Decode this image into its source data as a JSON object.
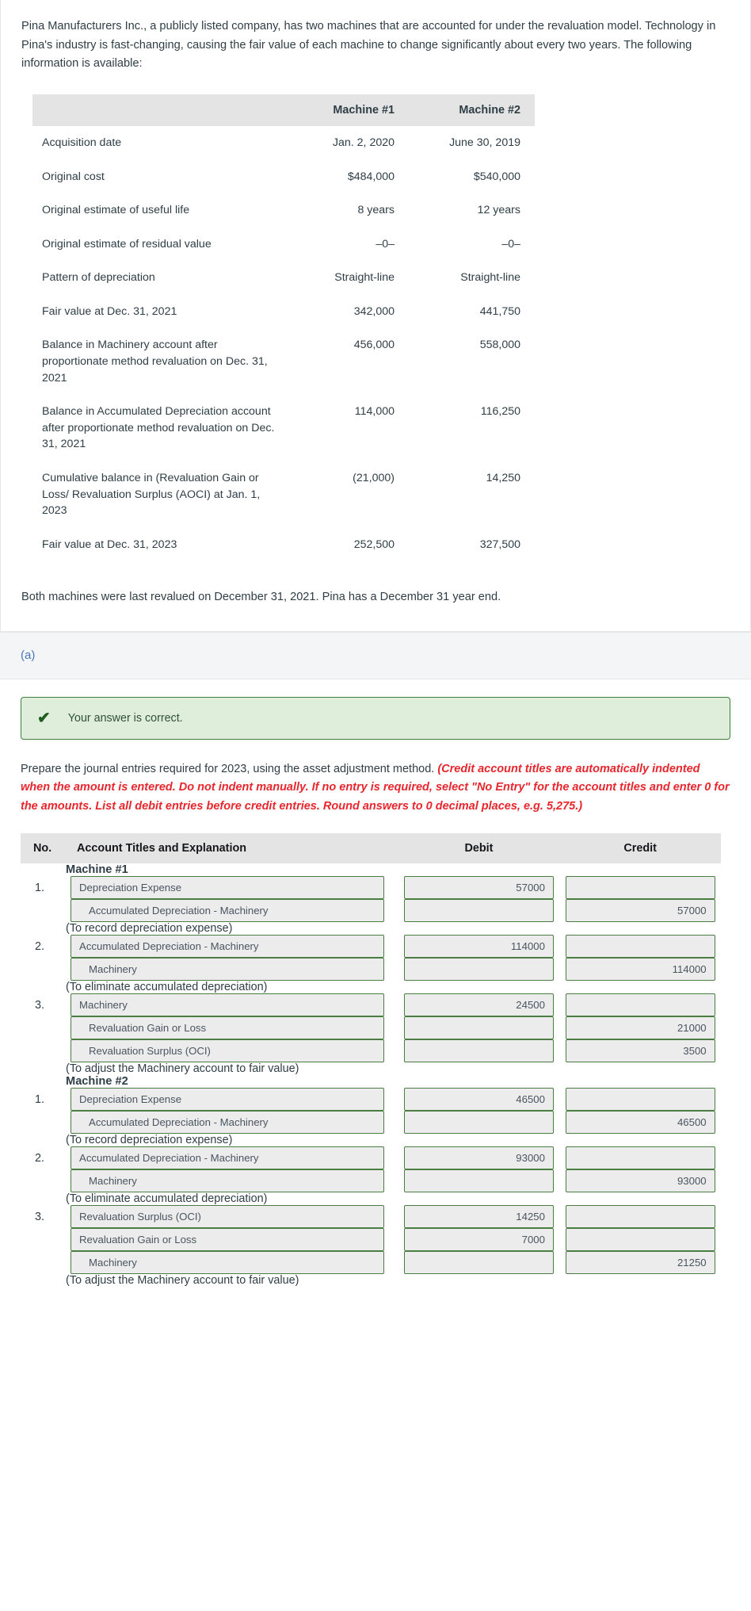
{
  "problem": {
    "intro": "Pina Manufacturers Inc., a publicly listed company, has two machines that are accounted for under the revaluation model. Technology in Pina's industry is fast-changing, causing the fair value of each machine to change significantly about every two years. The following information is available:",
    "closing_note": "Both machines were last revalued on December 31, 2021. Pina has a December 31 year end."
  },
  "data_table": {
    "headers": [
      "",
      "Machine #1",
      "Machine #2"
    ],
    "rows": [
      {
        "label": "Acquisition date",
        "m1": "Jan. 2, 2020",
        "m2": "June 30, 2019"
      },
      {
        "label": "Original cost",
        "m1": "$484,000",
        "m2": "$540,000"
      },
      {
        "label": "Original estimate of useful life",
        "m1": "8 years",
        "m2": "12 years"
      },
      {
        "label": "Original estimate of residual value",
        "m1": "–0–",
        "m2": "–0–"
      },
      {
        "label": "Pattern of depreciation",
        "m1": "Straight-line",
        "m2": "Straight-line"
      },
      {
        "label": "Fair value at Dec. 31, 2021",
        "m1": "342,000",
        "m2": "441,750"
      },
      {
        "label": "Balance in Machinery account after proportionate method revaluation on Dec. 31, 2021",
        "m1": "456,000",
        "m2": "558,000"
      },
      {
        "label": "Balance in Accumulated Depreciation account after proportionate method revaluation on Dec. 31, 2021",
        "m1": "114,000",
        "m2": "116,250"
      },
      {
        "label": "Cumulative balance in (Revaluation Gain or Loss/ Revaluation Surplus (AOCI) at Jan. 1, 2023",
        "m1": "(21,000)",
        "m2": "14,250"
      },
      {
        "label": "Fair value at Dec. 31, 2023",
        "m1": "252,500",
        "m2": "327,500"
      }
    ]
  },
  "part": {
    "label": "(a)"
  },
  "feedback": {
    "icon": "check-icon",
    "text": "Your answer is correct."
  },
  "instructions": {
    "lead": "Prepare the journal entries required for 2023, using the asset adjustment method. ",
    "hint": "(Credit account titles are automatically indented when the amount is entered. Do not indent manually. If no entry is required, select \"No Entry\" for the account titles and enter 0 for the amounts. List all debit entries before credit entries. Round answers to 0 decimal places, e.g. 5,275.)"
  },
  "journal": {
    "headers": {
      "no": "No.",
      "account": "Account Titles and Explanation",
      "debit": "Debit",
      "credit": "Credit"
    },
    "sections": [
      {
        "heading": "Machine #1",
        "entries": [
          {
            "no": "1.",
            "lines": [
              {
                "account": "Depreciation Expense",
                "indent": false,
                "debit": "57000",
                "credit": ""
              },
              {
                "account": "Accumulated Depreciation - Machinery",
                "indent": true,
                "debit": "",
                "credit": "57000"
              }
            ],
            "memo": "(To record depreciation expense)"
          },
          {
            "no": "2.",
            "lines": [
              {
                "account": "Accumulated Depreciation - Machinery",
                "indent": false,
                "debit": "114000",
                "credit": ""
              },
              {
                "account": "Machinery",
                "indent": true,
                "debit": "",
                "credit": "114000"
              }
            ],
            "memo": "(To eliminate accumulated depreciation)"
          },
          {
            "no": "3.",
            "lines": [
              {
                "account": "Machinery",
                "indent": false,
                "debit": "24500",
                "credit": ""
              },
              {
                "account": "Revaluation Gain or Loss",
                "indent": true,
                "debit": "",
                "credit": "21000"
              },
              {
                "account": "Revaluation Surplus (OCI)",
                "indent": true,
                "debit": "",
                "credit": "3500"
              }
            ],
            "memo": "(To adjust the Machinery account to fair value)"
          }
        ]
      },
      {
        "heading": "Machine #2",
        "entries": [
          {
            "no": "1.",
            "lines": [
              {
                "account": "Depreciation Expense",
                "indent": false,
                "debit": "46500",
                "credit": ""
              },
              {
                "account": "Accumulated Depreciation - Machinery",
                "indent": true,
                "debit": "",
                "credit": "46500"
              }
            ],
            "memo": "(To record depreciation expense)"
          },
          {
            "no": "2.",
            "lines": [
              {
                "account": "Accumulated Depreciation - Machinery",
                "indent": false,
                "debit": "93000",
                "credit": ""
              },
              {
                "account": "Machinery",
                "indent": true,
                "debit": "",
                "credit": "93000"
              }
            ],
            "memo": "(To eliminate accumulated depreciation)"
          },
          {
            "no": "3.",
            "lines": [
              {
                "account": "Revaluation Surplus (OCI)",
                "indent": false,
                "debit": "14250",
                "credit": ""
              },
              {
                "account": "Revaluation Gain or Loss",
                "indent": false,
                "debit": "7000",
                "credit": ""
              },
              {
                "account": "Machinery",
                "indent": true,
                "debit": "",
                "credit": "21250"
              }
            ],
            "memo": "(To adjust the Machinery account to fair value)"
          }
        ]
      }
    ]
  }
}
